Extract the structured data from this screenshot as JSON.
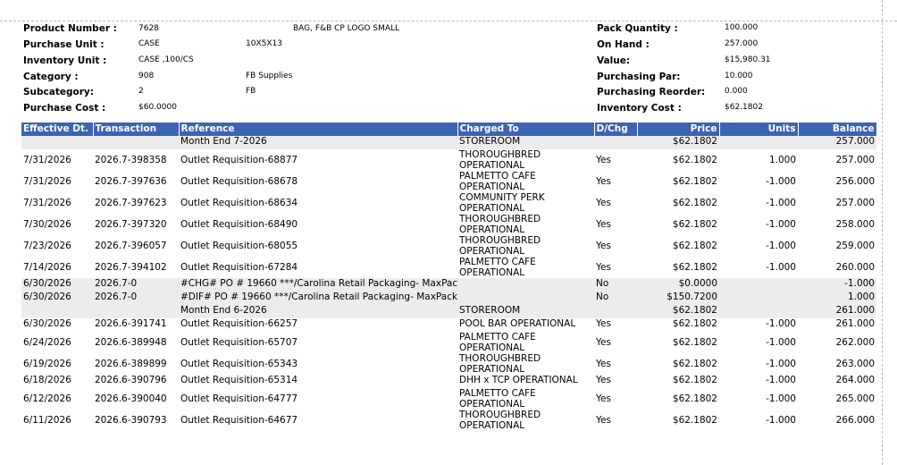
{
  "header": {
    "product_number_label": "Product Number :",
    "product_number": "7628",
    "product_desc": "BAG, F&B CP LOGO SMALL",
    "purchase_unit_label": "Purchase Unit :",
    "purchase_unit": "CASE",
    "purchase_size": "10X5X13",
    "inventory_unit_label": "Inventory Unit :",
    "inventory_unit": "CASE ,100/CS",
    "category_label": "Category :",
    "category": "908",
    "category_name": "FB Supplies",
    "subcategory_label": "Subcategory:",
    "subcategory": "2",
    "subcategory_name": "FB",
    "purchase_cost_label": "Purchase Cost :",
    "purchase_cost": "$60.0000",
    "pack_qty_label": "Pack Quantity :",
    "pack_qty": "100.000",
    "on_hand_label": "On Hand :",
    "on_hand": "257.000",
    "value_label": "Value:",
    "value": "$15,980.31",
    "purchasing_par_label": "Purchasing Par:",
    "purchasing_par": "10.000",
    "purchasing_reorder_label": "Purchasing Reorder:",
    "purchasing_reorder": "0.000",
    "inventory_cost_label": "Inventory Cost :",
    "inventory_cost": "$62.1802"
  },
  "table": {
    "columns": [
      "Effective Dt.",
      "Transaction",
      "Reference",
      "Charged To",
      "D/Chg",
      "Price",
      "Units",
      "Balance"
    ],
    "rows": [
      {
        "date": "",
        "trans": "",
        "ref": "Month End 7-2026",
        "charged": "STOREROOM",
        "charged2": "",
        "dchg": "",
        "price": "$62.1802",
        "units": "",
        "balance": "257.000",
        "shade": true
      },
      {
        "date": "7/31/2026",
        "trans": "2026.7-398358",
        "ref": "Outlet Requisition-68877",
        "charged": "THOROUGHBRED",
        "charged2": "OPERATIONAL",
        "dchg": "Yes",
        "price": "$62.1802",
        "units": "1.000",
        "balance": "257.000",
        "shade": false
      },
      {
        "date": "7/31/2026",
        "trans": "2026.7-397636",
        "ref": "Outlet Requisition-68678",
        "charged": "PALMETTO CAFE",
        "charged2": "OPERATIONAL",
        "dchg": "Yes",
        "price": "$62.1802",
        "units": "-1.000",
        "balance": "256.000",
        "shade": false
      },
      {
        "date": "7/31/2026",
        "trans": "2026.7-397623",
        "ref": "Outlet Requisition-68634",
        "charged": "COMMUNITY PERK",
        "charged2": "OPERATIONAL",
        "dchg": "Yes",
        "price": "$62.1802",
        "units": "-1.000",
        "balance": "257.000",
        "shade": false
      },
      {
        "date": "7/30/2026",
        "trans": "2026.7-397320",
        "ref": "Outlet Requisition-68490",
        "charged": "THOROUGHBRED",
        "charged2": "OPERATIONAL",
        "dchg": "Yes",
        "price": "$62.1802",
        "units": "-1.000",
        "balance": "258.000",
        "shade": false
      },
      {
        "date": "7/23/2026",
        "trans": "2026.7-396057",
        "ref": "Outlet Requisition-68055",
        "charged": "THOROUGHBRED",
        "charged2": "OPERATIONAL",
        "dchg": "Yes",
        "price": "$62.1802",
        "units": "-1.000",
        "balance": "259.000",
        "shade": false
      },
      {
        "date": "7/14/2026",
        "trans": "2026.7-394102",
        "ref": "Outlet Requisition-67284",
        "charged": "PALMETTO CAFE",
        "charged2": "OPERATIONAL",
        "dchg": "Yes",
        "price": "$62.1802",
        "units": "-1.000",
        "balance": "260.000",
        "shade": false
      },
      {
        "date": "6/30/2026",
        "trans": "2026.7-0",
        "ref": "#CHG# PO # 19660 ***/Carolina Retail Packaging- MaxPack",
        "charged": "",
        "charged2": "",
        "dchg": "No",
        "price": "$0.0000",
        "units": "",
        "balance": "-1.000",
        "shade": true
      },
      {
        "date": "6/30/2026",
        "trans": "2026.7-0",
        "ref": "#DIF# PO # 19660 ***/Carolina Retail Packaging- MaxPack",
        "charged": "",
        "charged2": "",
        "dchg": "No",
        "price": "$150.7200",
        "units": "",
        "balance": "1.000",
        "shade": true
      },
      {
        "date": "",
        "trans": "",
        "ref": "Month End 6-2026",
        "charged": "STOREROOM",
        "charged2": "",
        "dchg": "",
        "price": "$62.1802",
        "units": "",
        "balance": "261.000",
        "shade": true
      },
      {
        "date": "6/30/2026",
        "trans": "2026.6-391741",
        "ref": "Outlet Requisition-66257",
        "charged": "POOL BAR OPERATIONAL",
        "charged2": "",
        "dchg": "Yes",
        "price": "$62.1802",
        "units": "-1.000",
        "balance": "261.000",
        "shade": false
      },
      {
        "date": "6/24/2026",
        "trans": "2026.6-389948",
        "ref": "Outlet Requisition-65707",
        "charged": "PALMETTO CAFE",
        "charged2": "OPERATIONAL",
        "dchg": "Yes",
        "price": "$62.1802",
        "units": "-1.000",
        "balance": "262.000",
        "shade": false
      },
      {
        "date": "6/19/2026",
        "trans": "2026.6-389899",
        "ref": "Outlet Requisition-65343",
        "charged": "THOROUGHBRED",
        "charged2": "OPERATIONAL",
        "dchg": "Yes",
        "price": "$62.1802",
        "units": "-1.000",
        "balance": "263.000",
        "shade": false
      },
      {
        "date": "6/18/2026",
        "trans": "2026.6-390796",
        "ref": "Outlet Requisition-65314",
        "charged": "DHH x TCP OPERATIONAL",
        "charged2": "",
        "dchg": "Yes",
        "price": "$62.1802",
        "units": "-1.000",
        "balance": "264.000",
        "shade": false
      },
      {
        "date": "6/12/2026",
        "trans": "2026.6-390040",
        "ref": "Outlet Requisition-64777",
        "charged": "PALMETTO CAFE",
        "charged2": "OPERATIONAL",
        "dchg": "Yes",
        "price": "$62.1802",
        "units": "-1.000",
        "balance": "265.000",
        "shade": false
      },
      {
        "date": "6/11/2026",
        "trans": "2026.6-390793",
        "ref": "Outlet Requisition-64677",
        "charged": "THOROUGHBRED",
        "charged2": "OPERATIONAL",
        "dchg": "Yes",
        "price": "$62.1802",
        "units": "-1.000",
        "balance": "266.000",
        "shade": false
      }
    ]
  }
}
